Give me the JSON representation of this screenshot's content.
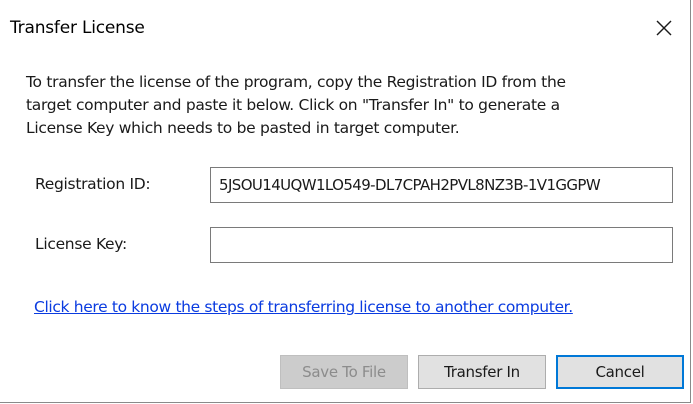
{
  "window": {
    "title": "Transfer License",
    "close_icon": "close-icon"
  },
  "instructions": {
    "line1": "To transfer the license of the program, copy the Registration ID from the",
    "line2": "target computer and paste it below. Click on \"Transfer In\" to generate a",
    "line3": "License Key which needs to be pasted in target computer."
  },
  "form": {
    "registration_id_label": "Registration ID:",
    "registration_id_value": "5JSOU14UQW1LO549-DL7CPAH2PVL8NZ3B-1V1GGPW",
    "license_key_label": "License Key:",
    "license_key_value": ""
  },
  "help_link": {
    "text": "Click here to know the steps of transferring license to another computer."
  },
  "buttons": {
    "save_to_file": "Save To File",
    "transfer_in": "Transfer In",
    "cancel": "Cancel"
  },
  "colors": {
    "link": "#0a3be0",
    "default_button_border": "#0078d7",
    "disabled_text": "#8c8c8c"
  }
}
